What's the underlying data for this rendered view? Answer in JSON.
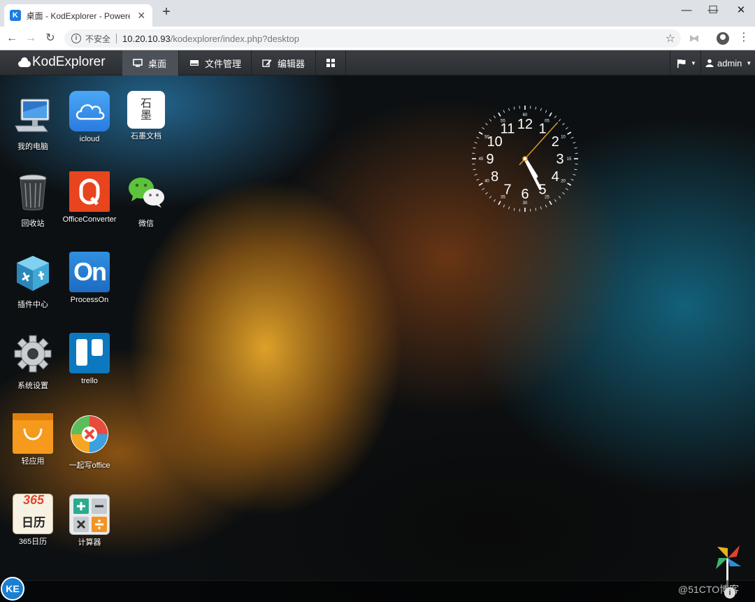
{
  "browser": {
    "tab_title": "桌面 - KodExplorer - Powered",
    "tab_favicon": "K",
    "new_tab": "+",
    "insecure_label": "不安全",
    "url_host": "10.20.10.93",
    "url_path": "/kodexplorer/index.php?desktop",
    "icons": [
      "back-icon",
      "forward-icon",
      "reload-icon",
      "info-icon",
      "star-icon",
      "extension-icon",
      "profile-icon",
      "menu-icon"
    ]
  },
  "app": {
    "brand": "KodExplorer",
    "tabs": [
      {
        "label": "桌面",
        "icon": "monitor-icon",
        "active": true
      },
      {
        "label": "文件管理",
        "icon": "hdd-icon",
        "active": false
      },
      {
        "label": "编辑器",
        "icon": "edit-icon",
        "active": false
      }
    ],
    "user": "admin"
  },
  "desktop": {
    "icons": [
      {
        "label": "我的电脑"
      },
      {
        "label": "icloud"
      },
      {
        "label": "石墨文档",
        "glyph": "石\n墨"
      },
      {
        "label": "回收站"
      },
      {
        "label": "OfficeConverter"
      },
      {
        "label": "微信"
      },
      {
        "label": "插件中心"
      },
      {
        "label": "ProcessOn",
        "glyph": "On"
      },
      {
        "label": "系统设置"
      },
      {
        "label": "trello"
      },
      {
        "label": "轻应用"
      },
      {
        "label": "一起写office"
      },
      {
        "label": "365日历",
        "glyph_top": "365",
        "glyph": "日历"
      },
      {
        "label": "计算器"
      }
    ]
  },
  "clock": {
    "hour_numbers": [
      "12",
      "1",
      "2",
      "3",
      "4",
      "5",
      "6",
      "7",
      "8",
      "9",
      "10",
      "11"
    ],
    "minute_labels": [
      "60",
      "05",
      "10",
      "15",
      "20",
      "25",
      "30",
      "35",
      "40",
      "45",
      "50",
      "55"
    ],
    "time": {
      "hours": 4.92,
      "minutes": 25.5,
      "seconds": 7
    }
  },
  "taskbar": {
    "start_label": "KE",
    "watermark": "@51CTO博客",
    "info_label": "i"
  },
  "colors": {
    "accent": "#1a7fd0",
    "appbar": "#2b2e31",
    "active_tab": "#4b5156"
  }
}
